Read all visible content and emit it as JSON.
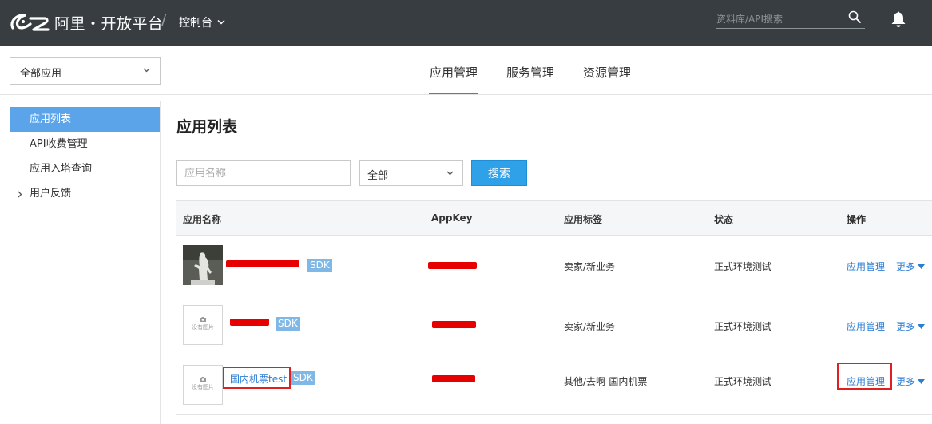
{
  "topbar": {
    "brand": "阿里・开放平台",
    "slash": "/",
    "console_label": "控制台",
    "search_placeholder": "资料库/API搜索"
  },
  "app_select": {
    "value": "全部应用"
  },
  "main_nav": {
    "tabs": [
      {
        "label": "应用管理",
        "active": true
      },
      {
        "label": "服务管理",
        "active": false
      },
      {
        "label": "资源管理",
        "active": false
      }
    ]
  },
  "sidebar": {
    "items": [
      {
        "label": "应用列表",
        "active": true
      },
      {
        "label": "API收费管理"
      },
      {
        "label": "应用入塔查询"
      },
      {
        "label": "用户反馈",
        "expandable": true
      }
    ]
  },
  "page": {
    "title": "应用列表",
    "filter_placeholder": "应用名称",
    "filter_select_value": "全部",
    "search_button": "搜索"
  },
  "table": {
    "headers": [
      "应用名称",
      "AppKey",
      "应用标签",
      "状态",
      "操作"
    ],
    "rows": [
      {
        "name": "",
        "badge": "SDK",
        "tag": "卖家/新业务",
        "status": "正式环境测试",
        "action": "应用管理",
        "more": "更多"
      },
      {
        "name": "",
        "badge": "SDK",
        "no_image": "没有图片",
        "tag": "卖家/新业务",
        "status": "正式环境测试",
        "action": "应用管理",
        "more": "更多"
      },
      {
        "name": "国内机票test",
        "badge": "SDK",
        "no_image": "没有图片",
        "tag": "其他/去啊-国内机票",
        "status": "正式环境测试",
        "action": "应用管理",
        "more": "更多"
      }
    ]
  },
  "colors": {
    "topbar": "#373d41",
    "accent": "#00a2ca",
    "sidebar_active": "#5ba4e9",
    "button": "#2fa1e8",
    "link": "#2b7cd3",
    "highlight": "#e02020"
  }
}
